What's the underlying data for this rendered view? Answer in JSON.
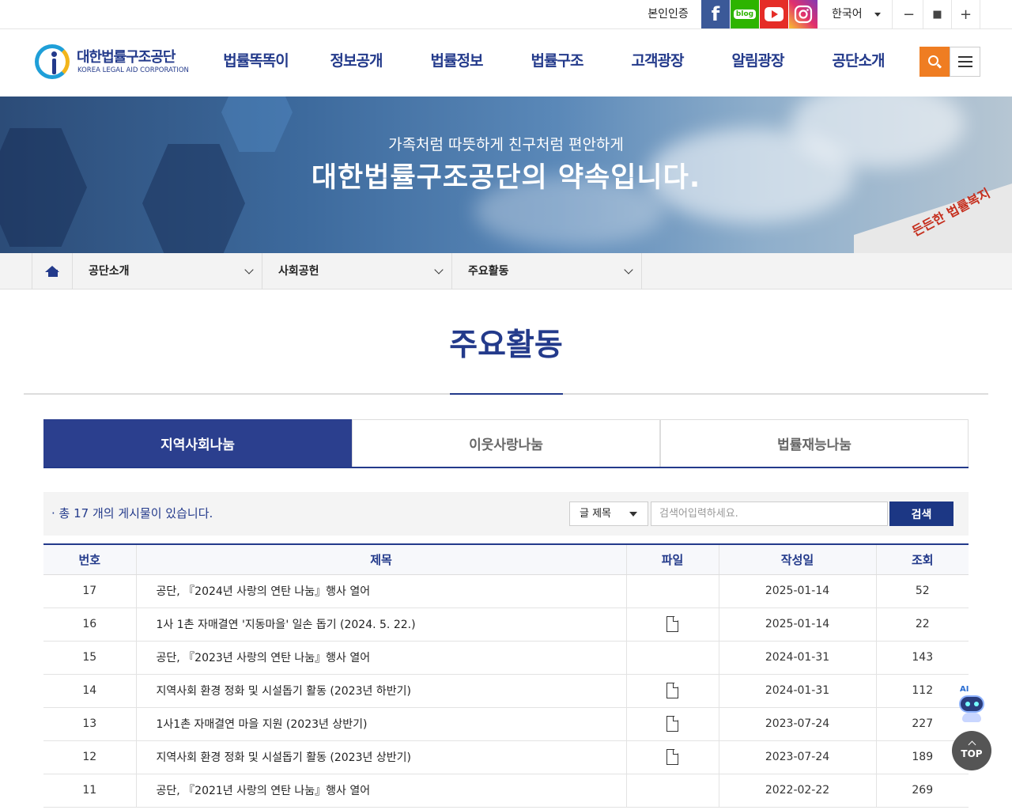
{
  "topbar": {
    "auth_label": "본인인증",
    "sns": [
      "facebook-icon",
      "blog-icon",
      "youtube-icon",
      "instagram-icon"
    ],
    "blog_text": "blog",
    "language": "한국어",
    "zoom_out": "−",
    "zoom_reset": "■",
    "zoom_in": "+"
  },
  "header": {
    "logo_ko": "대한법률구조공단",
    "logo_en": "KOREA LEGAL AID CORPORATION",
    "nav": [
      "법률똑똑이",
      "정보공개",
      "법률정보",
      "법률구조",
      "고객광장",
      "알림광장",
      "공단소개"
    ]
  },
  "banner": {
    "subtitle": "가족처럼 따뜻하게 친구처럼 편안하게",
    "title": "대한법률구조공단의 약속입니다.",
    "building_sign": "든든한 법률복지"
  },
  "breadcrumb": [
    "공단소개",
    "사회공헌",
    "주요활동"
  ],
  "page_title": "주요활동",
  "tabs": [
    {
      "label": "지역사회나눔",
      "active": true
    },
    {
      "label": "이웃사랑나눔",
      "active": false
    },
    {
      "label": "법률재능나눔",
      "active": false
    }
  ],
  "search": {
    "count_text": "· 총 17 개의 게시물이 있습니다.",
    "field_selected": "글 제목",
    "placeholder": "검색어입력하세요.",
    "button": "검색"
  },
  "table": {
    "headers": [
      "번호",
      "제목",
      "파일",
      "작성일",
      "조회"
    ],
    "rows": [
      {
        "no": "17",
        "title": "공단, 『2024년 사랑의 연탄 나눔』행사 열어",
        "file": false,
        "date": "2025-01-14",
        "views": "52"
      },
      {
        "no": "16",
        "title": "1사 1촌 자매결연 '지동마을' 일손 돕기 (2024. 5. 22.)",
        "file": true,
        "date": "2025-01-14",
        "views": "22"
      },
      {
        "no": "15",
        "title": "공단, 『2023년 사랑의 연탄 나눔』행사 열어",
        "file": false,
        "date": "2024-01-31",
        "views": "143"
      },
      {
        "no": "14",
        "title": "지역사회 환경 정화 및 시설돕기 활동 (2023년 하반기)",
        "file": true,
        "date": "2024-01-31",
        "views": "112"
      },
      {
        "no": "13",
        "title": "1사1촌 자매결연 마을 지원 (2023년 상반기)",
        "file": true,
        "date": "2023-07-24",
        "views": "227"
      },
      {
        "no": "12",
        "title": "지역사회 환경 정화 및 시설돕기 활동 (2023년 상반기)",
        "file": true,
        "date": "2023-07-24",
        "views": "189"
      },
      {
        "no": "11",
        "title": "공단, 『2021년 사랑의 연탄 나눔』행사 열어",
        "file": false,
        "date": "2022-02-22",
        "views": "269"
      }
    ]
  },
  "floating": {
    "ai_label": "AI",
    "top_label": "TOP"
  },
  "colors": {
    "brand_navy": "#233a8b",
    "search_orange": "#ef7d22",
    "active_tab": "#2b3f8e"
  }
}
